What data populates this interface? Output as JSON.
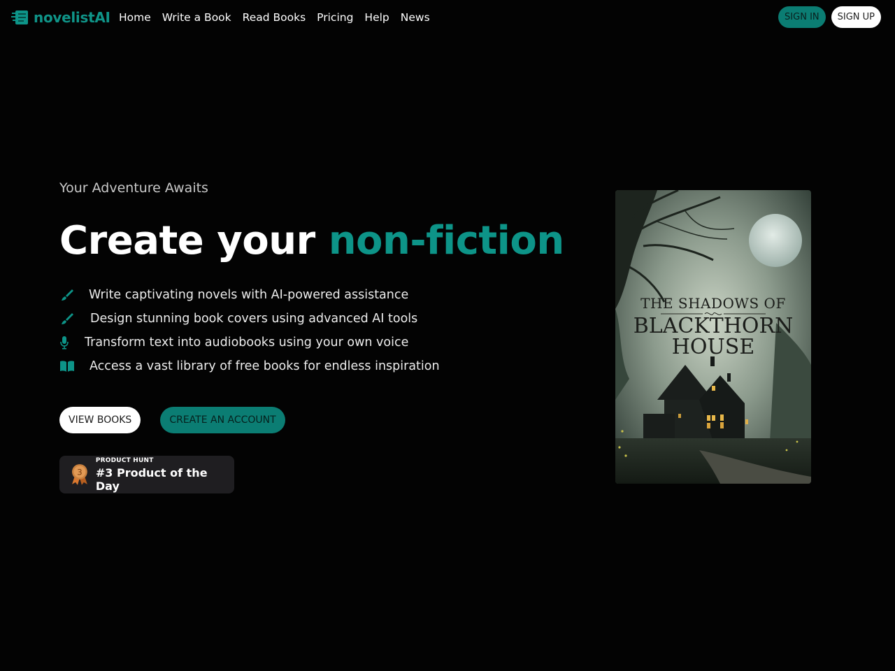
{
  "brand": {
    "name": "novelistAI",
    "accent": "#0d9488"
  },
  "nav": {
    "items": [
      {
        "label": "Home"
      },
      {
        "label": "Write a Book"
      },
      {
        "label": "Read Books"
      },
      {
        "label": "Pricing"
      },
      {
        "label": "Help"
      },
      {
        "label": "News"
      }
    ]
  },
  "auth": {
    "sign_in": "SIGN IN",
    "sign_up": "SIGN UP"
  },
  "hero": {
    "eyebrow": "Your Adventure Awaits",
    "headline_prefix": "Create your ",
    "headline_accent": "non-fiction",
    "features": [
      {
        "icon": "paintbrush-icon",
        "text": "Write captivating novels with AI-powered assistance"
      },
      {
        "icon": "paintbrush-icon",
        "text": "Design stunning book covers using advanced AI tools"
      },
      {
        "icon": "microphone-icon",
        "text": "Transform text into audiobooks using your own voice"
      },
      {
        "icon": "open-book-icon",
        "text": "Access a vast library of free books for endless inspiration"
      }
    ],
    "buttons": {
      "view_books": "VIEW BOOKS",
      "create_account": "CREATE AN ACCOUNT"
    }
  },
  "product_hunt": {
    "label": "PRODUCT HUNT",
    "title": "#3 Product of the Day",
    "rank": "3"
  },
  "cover": {
    "line1": "THE SHADOWS OF",
    "line2": "BLACKTHORN",
    "line3": "HOUSE"
  }
}
